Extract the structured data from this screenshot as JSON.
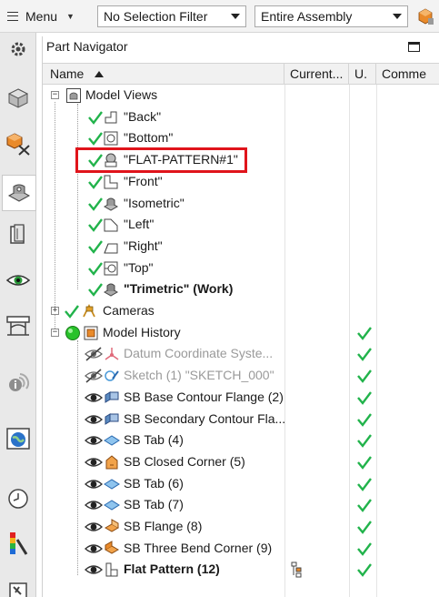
{
  "toolbar": {
    "menu_label": "Menu",
    "selection_filter": "No Selection Filter",
    "scope": "Entire Assembly"
  },
  "sidebar": {
    "icons": [
      "settings-icon",
      "assembly-navigator-icon",
      "constraint-navigator-icon",
      "part-navigator-icon",
      "reuse-library-icon",
      "visualization-icon",
      "roles-icon",
      "web-browser-icon",
      "history-icon",
      "palette-icon",
      "tools-icon"
    ]
  },
  "panel": {
    "title": "Part Navigator",
    "columns": {
      "name": "Name",
      "current": "Current...",
      "u": "U.",
      "comment": "Comme"
    }
  },
  "tree": {
    "model_views": "Model Views",
    "views": [
      "\"Back\"",
      "\"Bottom\"",
      "\"FLAT-PATTERN#1\"",
      "\"Front\"",
      "\"Isometric\"",
      "\"Left\"",
      "\"Right\"",
      "\"Top\"",
      "\"Trimetric\" (Work)"
    ],
    "cameras": "Cameras",
    "model_history": "Model History",
    "features": [
      "Datum Coordinate Syste...",
      "Sketch (1) \"SKETCH_000\"",
      "SB Base Contour Flange (2)",
      "SB Secondary Contour Fla...",
      "SB Tab (4)",
      "SB Closed Corner (5)",
      "SB Tab (6)",
      "SB Tab (7)",
      "SB Flange (8)",
      "SB Three Bend Corner (9)",
      "Flat Pattern (12)"
    ]
  },
  "colors": {
    "check_green": "#21b34b",
    "highlight_red": "#e0141b",
    "history_ball": "#28c22a"
  }
}
